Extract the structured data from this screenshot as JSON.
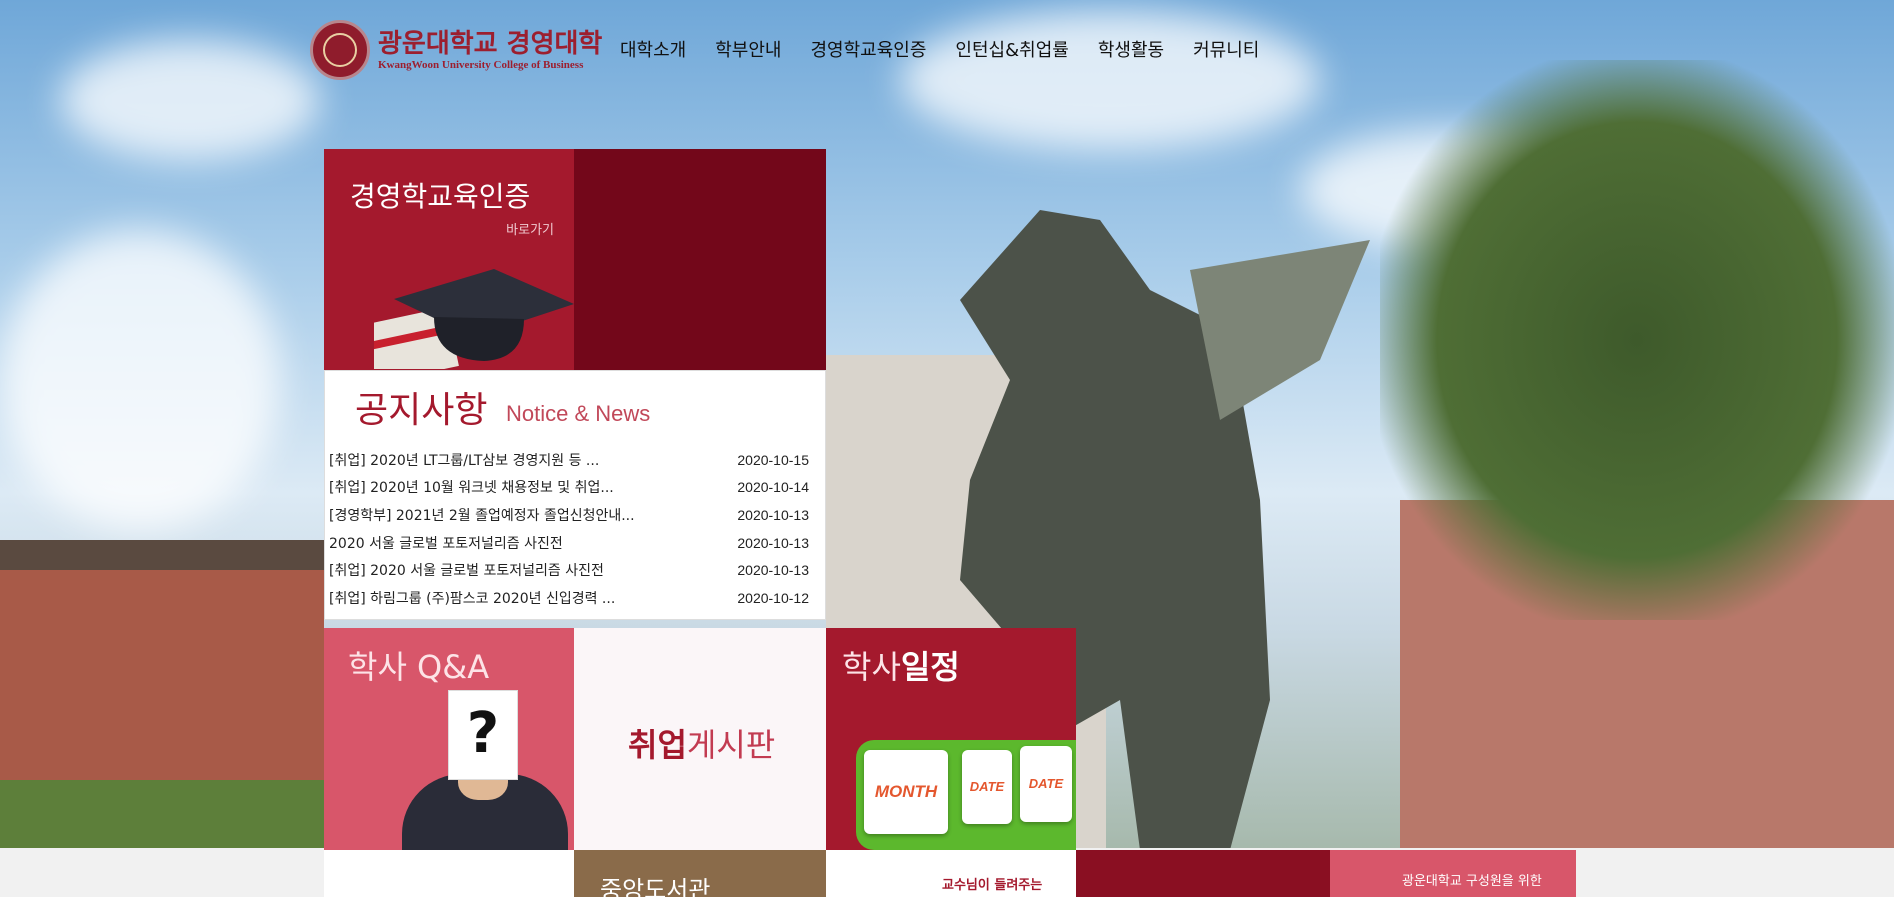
{
  "header": {
    "logo_kr": "광운대학교 경영대학",
    "logo_en": "KwangWoon University College of Business",
    "nav": [
      "대학소개",
      "학부안내",
      "경영학교육인증",
      "인턴십&취업률",
      "학생활동",
      "커뮤니티"
    ]
  },
  "tiles": {
    "cert": {
      "title": "경영학교육인증",
      "link": "바로가기"
    },
    "notice": {
      "title": "공지사항",
      "subtitle": "Notice & News",
      "items": [
        {
          "text": "[취업] 2020년 LT그룹/LT삼보 경영지원 등 ...",
          "date": "2020-10-15"
        },
        {
          "text": "[취업] 2020년 10월 워크넷 채용정보 및 취업...",
          "date": "2020-10-14"
        },
        {
          "text": "[경영학부] 2021년 2월 졸업예정자 졸업신청안내...",
          "date": "2020-10-13"
        },
        {
          "text": "2020 서울 글로벌 포토저널리즘 사진전",
          "date": "2020-10-13"
        },
        {
          "text": "[취업] 2020 서울 글로벌 포토저널리즘 사진전",
          "date": "2020-10-13"
        },
        {
          "text": "[취업] 하림그룹 (주)팜스코 2020년 신입경력 ...",
          "date": "2020-10-12"
        }
      ]
    },
    "qa": {
      "title": "학사 Q&A",
      "card": "?"
    },
    "job": {
      "title_bold": "취업",
      "title_rest": "게시판"
    },
    "schedule": {
      "title_light": "학사",
      "title_bold": "일정",
      "cal_month": "MONTH",
      "cal_date1": "DATE",
      "cal_date2": "DATE"
    },
    "bottom": {
      "library": "중앙도서관",
      "professor": "교수님이 들려주는",
      "members": "광운대학교 구성원을 위한"
    }
  },
  "colors": {
    "brand": "#a4192d",
    "brand_dark": "#73071a",
    "pink": "#d8566a",
    "green": "#5cb82d"
  }
}
